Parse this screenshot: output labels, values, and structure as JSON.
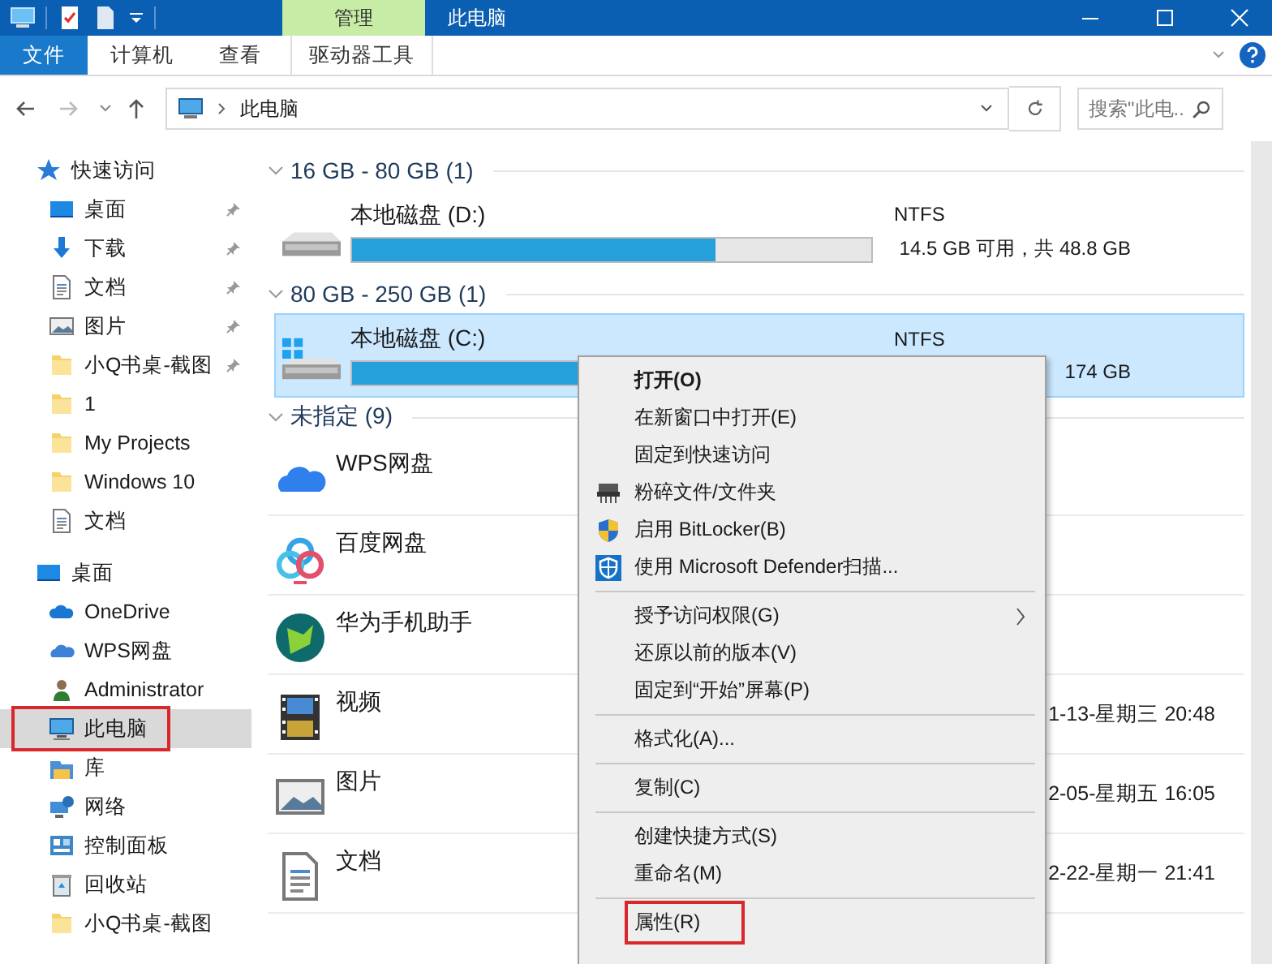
{
  "window": {
    "title": "此电脑",
    "context_tab": "管理"
  },
  "ribbon_tabs": [
    {
      "label": "文件",
      "kind": "file"
    },
    {
      "label": "计算机",
      "kind": "tab"
    },
    {
      "label": "查看",
      "kind": "tab"
    },
    {
      "label": "驱动器工具",
      "kind": "context"
    }
  ],
  "address": {
    "path": "此电脑"
  },
  "search": {
    "placeholder": "搜索\"此电..."
  },
  "sidebar": [
    {
      "label": "快速访问",
      "kind": "star",
      "selected": false,
      "highlighted": false,
      "children": [
        {
          "label": "桌面",
          "kind": "desktop",
          "pinned": true,
          "selected": false,
          "highlighted": false
        },
        {
          "label": "下载",
          "kind": "download",
          "pinned": true,
          "selected": false,
          "highlighted": false
        },
        {
          "label": "文档",
          "kind": "document",
          "pinned": true,
          "selected": false,
          "highlighted": false
        },
        {
          "label": "图片",
          "kind": "picture",
          "pinned": true,
          "selected": false,
          "highlighted": false
        },
        {
          "label": "小Q书桌-截图",
          "kind": "folder",
          "pinned": true,
          "selected": false,
          "highlighted": false
        },
        {
          "label": "1",
          "kind": "folder",
          "pinned": false,
          "selected": false,
          "highlighted": false
        },
        {
          "label": "My Projects",
          "kind": "folder",
          "pinned": false,
          "selected": false,
          "highlighted": false
        },
        {
          "label": "Windows 10",
          "kind": "folder",
          "pinned": false,
          "selected": false,
          "highlighted": false
        },
        {
          "label": "文档",
          "kind": "document",
          "pinned": false,
          "selected": false,
          "highlighted": false
        }
      ]
    },
    {
      "label": "桌面",
      "kind": "desktop",
      "selected": false,
      "highlighted": false,
      "children": [
        {
          "label": "OneDrive",
          "kind": "onedrive",
          "pinned": false,
          "selected": false,
          "highlighted": false
        },
        {
          "label": "WPS网盘",
          "kind": "wps",
          "pinned": false,
          "selected": false,
          "highlighted": false
        },
        {
          "label": "Administrator",
          "kind": "user",
          "pinned": false,
          "selected": false,
          "highlighted": false
        },
        {
          "label": "此电脑",
          "kind": "computer",
          "pinned": false,
          "selected": true,
          "highlighted": true
        },
        {
          "label": "库",
          "kind": "library",
          "pinned": false,
          "selected": false,
          "highlighted": false
        },
        {
          "label": "网络",
          "kind": "network",
          "pinned": false,
          "selected": false,
          "highlighted": false
        },
        {
          "label": "控制面板",
          "kind": "control",
          "pinned": false,
          "selected": false,
          "highlighted": false
        },
        {
          "label": "回收站",
          "kind": "recycle",
          "pinned": false,
          "selected": false,
          "highlighted": false
        },
        {
          "label": "小Q书桌-截图",
          "kind": "folder",
          "pinned": false,
          "selected": false,
          "highlighted": false
        }
      ]
    }
  ],
  "groups": [
    {
      "title": "16 GB - 80 GB (1)",
      "entries": [
        {
          "name": "本地磁盘 (D:)",
          "kind": "drive",
          "selected": false,
          "level": 0.7,
          "filesystem": "NTFS",
          "free": "14.5 GB 可用，共 48.8 GB"
        }
      ]
    },
    {
      "title": "80 GB - 250 GB (1)",
      "entries": [
        {
          "name": "本地磁盘 (C:)",
          "kind": "system-drive",
          "selected": true,
          "level": 0.8,
          "filesystem": "NTFS",
          "free": "174 GB"
        }
      ]
    },
    {
      "title": "未指定 (9)",
      "entries": [
        {
          "name": "WPS网盘",
          "kind": "cloud"
        },
        {
          "name": "百度网盘",
          "kind": "baidu"
        },
        {
          "name": "华为手机助手",
          "kind": "huawei"
        },
        {
          "name": "视频",
          "kind": "video",
          "date": "1-13-星期三 20:48"
        },
        {
          "name": "图片",
          "kind": "picture",
          "date": "2-05-星期五 16:05"
        },
        {
          "name": "文档",
          "kind": "document",
          "date": "2-22-星期一 21:41"
        }
      ]
    }
  ],
  "context_menu": [
    {
      "kind": "plain",
      "label": "打开(O)",
      "default": true,
      "submenu": false,
      "highlighted": false
    },
    {
      "kind": "plain",
      "label": "在新窗口中打开(E)",
      "default": false,
      "submenu": false,
      "highlighted": false
    },
    {
      "kind": "plain",
      "label": "固定到快速访问",
      "default": false,
      "submenu": false,
      "highlighted": false
    },
    {
      "kind": "shredder",
      "label": "粉碎文件/文件夹",
      "default": false,
      "submenu": false,
      "highlighted": false
    },
    {
      "kind": "uac",
      "label": "启用 BitLocker(B)",
      "default": false,
      "submenu": false,
      "highlighted": false
    },
    {
      "kind": "defender",
      "label": "使用 Microsoft Defender扫描...",
      "default": false,
      "submenu": false,
      "highlighted": false
    },
    {
      "kind": "separator"
    },
    {
      "kind": "plain",
      "label": "授予访问权限(G)",
      "default": false,
      "submenu": true,
      "highlighted": false
    },
    {
      "kind": "plain",
      "label": "还原以前的版本(V)",
      "default": false,
      "submenu": false,
      "highlighted": false
    },
    {
      "kind": "plain",
      "label": "固定到“开始”屏幕(P)",
      "default": false,
      "submenu": false,
      "highlighted": false
    },
    {
      "kind": "separator"
    },
    {
      "kind": "plain",
      "label": "格式化(A)...",
      "default": false,
      "submenu": false,
      "highlighted": false
    },
    {
      "kind": "separator"
    },
    {
      "kind": "plain",
      "label": "复制(C)",
      "default": false,
      "submenu": false,
      "highlighted": false
    },
    {
      "kind": "separator"
    },
    {
      "kind": "plain",
      "label": "创建快捷方式(S)",
      "default": false,
      "submenu": false,
      "highlighted": false
    },
    {
      "kind": "plain",
      "label": "重命名(M)",
      "default": false,
      "submenu": false,
      "highlighted": false
    },
    {
      "kind": "separator"
    },
    {
      "kind": "plain",
      "label": "属性(R)",
      "default": false,
      "submenu": false,
      "highlighted": true
    }
  ]
}
